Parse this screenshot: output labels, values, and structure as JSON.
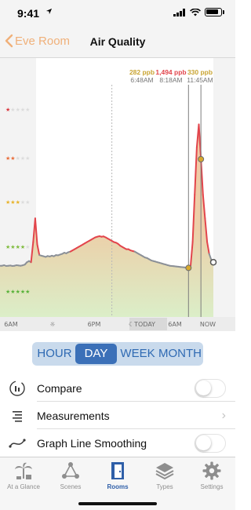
{
  "status_bar": {
    "time": "9:41",
    "location_icon": "location-arrow-icon",
    "wifi_icon": "wifi-icon",
    "battery_icon": "battery-icon"
  },
  "nav": {
    "back_label": "Eve Room",
    "title": "Air Quality"
  },
  "colors": {
    "accent": "#f0b079",
    "line": "#8b9097",
    "danger": "#e2454c",
    "gold": "#c9a432",
    "active_tab": "#2f5fa8"
  },
  "chart_data": {
    "type": "area",
    "y_rating_labels": [
      "★★★★★",
      "★★★★★",
      "★★★★★",
      "★★★★★",
      "★★★★★"
    ],
    "x_tick_labels": [
      "6AM",
      "☼",
      "6PM",
      "☾TODAY",
      "6AM",
      "NOW"
    ],
    "markers": [
      {
        "value": "282 ppb",
        "time": "6:48AM",
        "color": "#c9a432"
      },
      {
        "value": "1,494 ppb",
        "time": "8:18AM",
        "color": "#e2454c"
      },
      {
        "value": "330 ppb",
        "time": "11:45AM",
        "color": "#c9a432"
      }
    ],
    "series": [
      {
        "values": [
          300,
          300,
          305,
          298,
          300,
          302,
          298,
          300,
          305,
          302,
          300,
          304,
          310,
          330,
          340,
          330,
          500,
          700,
          480,
          390,
          385,
          380,
          375,
          382,
          378,
          385,
          380,
          390,
          388,
          395,
          400,
          410,
          405,
          415,
          420,
          430,
          440,
          450,
          460,
          470,
          480,
          490,
          500,
          510,
          520,
          530,
          540,
          545,
          550,
          545,
          548,
          540,
          530,
          520,
          510,
          500,
          495,
          485,
          470,
          460,
          450,
          440,
          440,
          430,
          425,
          420,
          410,
          400,
          390,
          380,
          370,
          365,
          355,
          345,
          340,
          335,
          330,
          325,
          320,
          315,
          310,
          305,
          300,
          298,
          296,
          294,
          292,
          290,
          288,
          286,
          284,
          282,
          300,
          500,
          900,
          1300,
          1494,
          1200,
          900,
          700,
          500,
          400,
          350,
          330
        ]
      }
    ]
  },
  "segments": {
    "items": [
      "HOUR",
      "DAY",
      "WEEK",
      "MONTH"
    ],
    "active": "DAY"
  },
  "rows": {
    "compare": "Compare",
    "measurements": "Measurements",
    "smoothing": "Graph Line Smoothing"
  },
  "tabs": [
    {
      "label": "At a Glance",
      "icon": "palm-tree-icon"
    },
    {
      "label": "Scenes",
      "icon": "scenes-icon"
    },
    {
      "label": "Rooms",
      "icon": "door-icon"
    },
    {
      "label": "Types",
      "icon": "layers-icon"
    },
    {
      "label": "Settings",
      "icon": "gear-icon"
    }
  ]
}
